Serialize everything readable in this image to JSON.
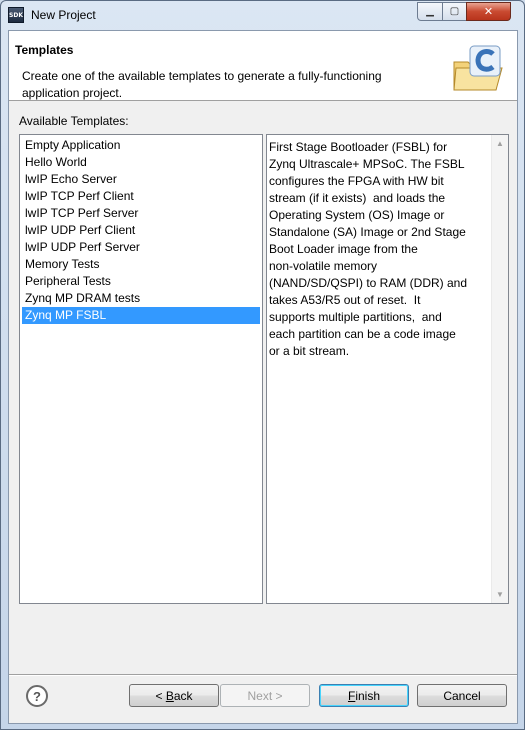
{
  "window": {
    "title": "New Project",
    "icon_label": "SDK",
    "controls": {
      "minimize_icon": "minimize-icon",
      "maximize_icon": "maximize-icon",
      "close_icon": "close-icon"
    }
  },
  "header": {
    "title": "Templates",
    "description": "Create one of the available templates to generate a fully-functioning application project."
  },
  "templates": {
    "label": "Available Templates:",
    "items": [
      "Empty Application",
      "Hello World",
      "lwIP Echo Server",
      "lwIP TCP Perf Client",
      "lwIP TCP Perf Server",
      "lwIP UDP Perf Client",
      "lwIP UDP Perf Server",
      "Memory Tests",
      "Peripheral Tests",
      "Zynq MP DRAM tests",
      "Zynq MP FSBL"
    ],
    "selected_index": 10
  },
  "description": {
    "text": "First Stage Bootloader (FSBL) for\nZynq Ultrascale+ MPSoC. The FSBL\nconfigures the FPGA with HW bit\nstream (if it exists)  and loads the\nOperating System (OS) Image or\nStandalone (SA) Image or 2nd Stage\nBoot Loader image from the\nnon-volatile memory\n(NAND/SD/QSPI) to RAM (DDR) and\ntakes A53/R5 out of reset.  It\nsupports multiple partitions,  and\neach partition can be a code image\nor a bit stream."
  },
  "buttons": {
    "help": "?",
    "back_prefix": "< ",
    "back_mnemonic": "B",
    "back_rest": "ack",
    "next": "Next >",
    "finish_mnemonic": "F",
    "finish_rest": "inish",
    "cancel": "Cancel"
  },
  "colors": {
    "selection": "#3399ff",
    "dialog_bg": "#f0f0f0"
  }
}
